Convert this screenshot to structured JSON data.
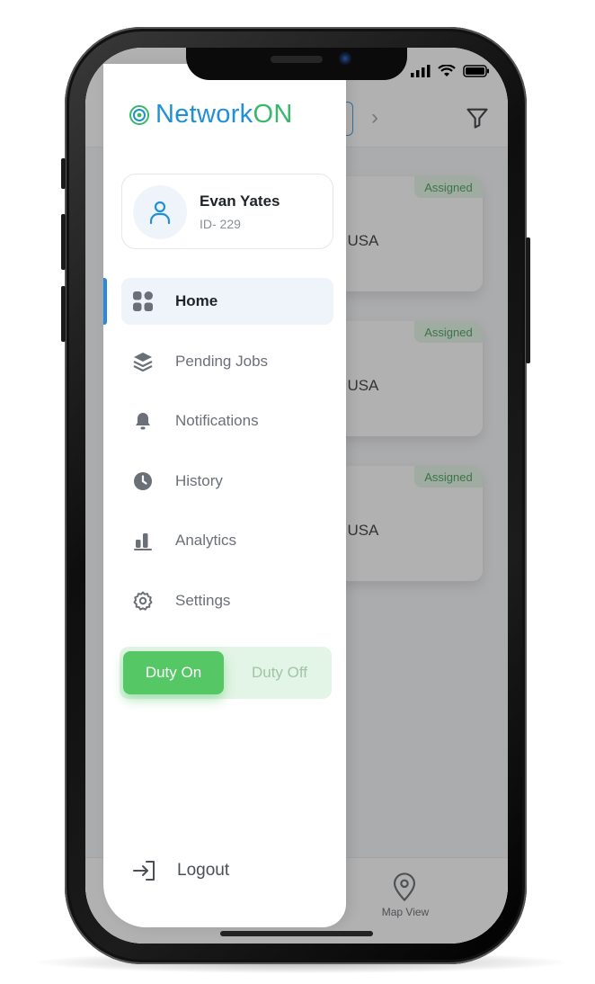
{
  "app": {
    "logo_part1": "Network",
    "logo_part2": "ON",
    "colors": {
      "brand_blue": "#1f8fd6",
      "brand_green": "#38b86a",
      "duty_on_bg": "#55c765",
      "active_bg": "#eef4fa"
    }
  },
  "user": {
    "name": "Evan Yates",
    "id": "ID- 229"
  },
  "menu": {
    "items": [
      {
        "label": "Home",
        "icon": "grid-icon",
        "active": true
      },
      {
        "label": "Pending Jobs",
        "icon": "layers-icon",
        "active": false
      },
      {
        "label": "Notifications",
        "icon": "bell-icon",
        "active": false
      },
      {
        "label": "History",
        "icon": "clock-icon",
        "active": false
      },
      {
        "label": "Analytics",
        "icon": "bar-chart-icon",
        "active": false
      },
      {
        "label": "Settings",
        "icon": "gear-icon",
        "active": false
      }
    ]
  },
  "duty": {
    "on_label": "Duty On",
    "off_label": "Duty Off",
    "selected": "on"
  },
  "logout": {
    "label": "Logout",
    "icon": "logout-icon"
  },
  "background": {
    "cards": [
      {
        "badge": "Assigned",
        "location": ", USA"
      },
      {
        "badge": "Assigned",
        "location": ", USA"
      },
      {
        "badge": "Assigned",
        "location": ", USA"
      }
    ],
    "bottom_nav": {
      "map_label": "Map View",
      "map_icon": "map-pin-icon"
    },
    "header_icons": [
      "chevron-right-icon",
      "filter-icon"
    ]
  }
}
